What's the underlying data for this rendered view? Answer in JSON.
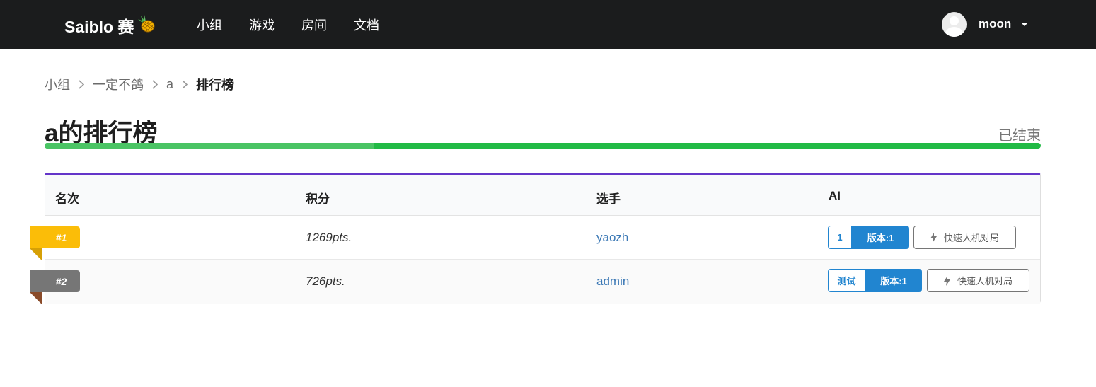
{
  "navbar": {
    "brand": "Saiblo 赛",
    "items": [
      "小组",
      "游戏",
      "房间",
      "文档"
    ],
    "username": "moon"
  },
  "breadcrumb": [
    "小组",
    "一定不鸽",
    "a",
    "排行榜"
  ],
  "title": "a的排行榜",
  "status": "已结束",
  "progress": {
    "first_segment_fraction": 0.33,
    "colors": [
      "#4ac464",
      "#21ba45"
    ]
  },
  "table": {
    "headers": [
      "名次",
      "积分",
      "选手",
      "AI"
    ],
    "rows": [
      {
        "rank": "#1",
        "points": "1269pts.",
        "player": "yaozh",
        "ai_label": "1",
        "version": "版本:1",
        "action": "快速人机对局",
        "ribbon_color": "#fbbd08",
        "fold_color": "#d6a006"
      },
      {
        "rank": "#2",
        "points": "726pts.",
        "player": "admin",
        "ai_label": "测试",
        "version": "版本:1",
        "action": "快速人机对局",
        "ribbon_color": "#767676",
        "fold_color": "#8a4b2a"
      }
    ]
  },
  "colors": {
    "accent": "#2185d0",
    "table_top": "#6435c9",
    "navbar": "#1b1c1d"
  }
}
